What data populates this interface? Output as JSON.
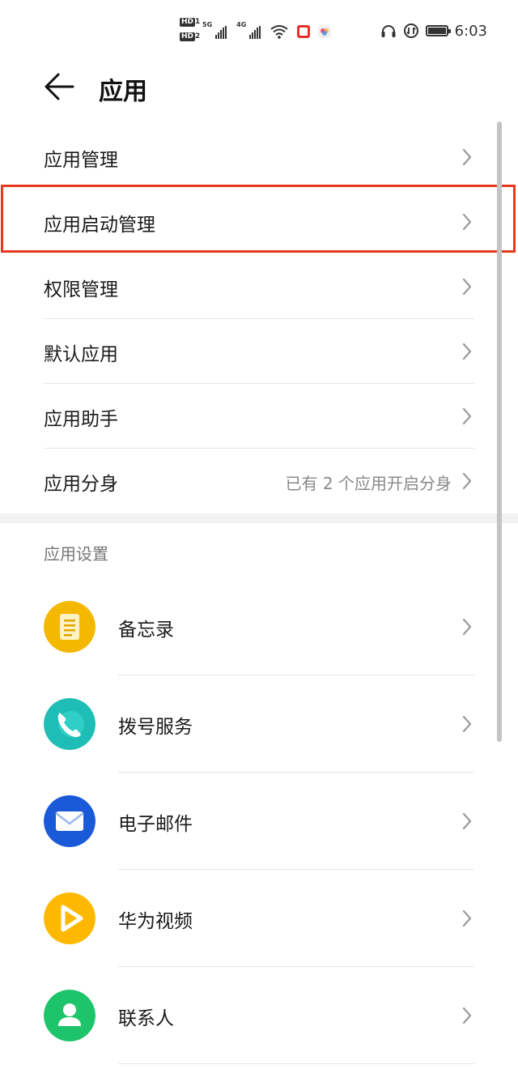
{
  "status_bar": {
    "sim1": "HD",
    "sim2": "HD",
    "sim1_index": "1",
    "sim2_index": "2",
    "net1": "5G",
    "net2": "4G",
    "time": "6:03",
    "icons": [
      "signal-icon",
      "signal-icon",
      "wifi-icon",
      "notification-icon",
      "app-notification-icon",
      "headphones-icon",
      "data-saver-icon",
      "battery-icon"
    ]
  },
  "header": {
    "title": "应用"
  },
  "menu": {
    "items": [
      {
        "label": "应用管理",
        "value": ""
      },
      {
        "label": "应用启动管理",
        "value": "",
        "highlighted": true
      },
      {
        "label": "权限管理",
        "value": ""
      },
      {
        "label": "默认应用",
        "value": ""
      },
      {
        "label": "应用助手",
        "value": ""
      },
      {
        "label": "应用分身",
        "value": "已有 2 个应用开启分身"
      }
    ]
  },
  "section": {
    "title": "应用设置"
  },
  "apps": [
    {
      "label": "备忘录",
      "icon": "notepad-icon",
      "color": "#f5b800"
    },
    {
      "label": "拨号服务",
      "icon": "phone-icon",
      "color": "#1ebdb5"
    },
    {
      "label": "电子邮件",
      "icon": "mail-icon",
      "color": "#1a5ad9"
    },
    {
      "label": "华为视频",
      "icon": "play-icon",
      "color": "#ffb800"
    },
    {
      "label": "联系人",
      "icon": "contact-icon",
      "color": "#1ec46a"
    }
  ],
  "colors": {
    "highlight_border": "#e8391e",
    "chevron": "#9a9a9a",
    "secondary_text": "#888888"
  }
}
